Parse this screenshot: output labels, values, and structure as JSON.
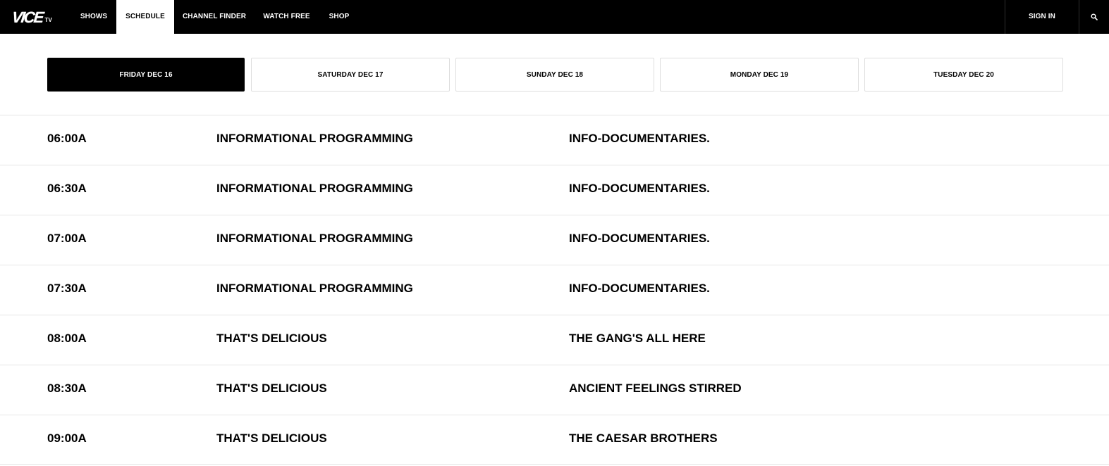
{
  "nav": {
    "logo_main": "VICE",
    "logo_suffix": "TV",
    "items": [
      {
        "label": "SHOWS"
      },
      {
        "label": "SCHEDULE"
      },
      {
        "label": "CHANNEL FINDER"
      },
      {
        "label": "WATCH FREE"
      },
      {
        "label": "SHOP"
      }
    ],
    "active_item": "SCHEDULE",
    "sign_in": "SIGN IN",
    "search_icon": "search-icon"
  },
  "date_tabs": [
    {
      "label": "FRIDAY DEC 16",
      "active": true
    },
    {
      "label": "SATURDAY DEC 17",
      "active": false
    },
    {
      "label": "SUNDAY DEC 18",
      "active": false
    },
    {
      "label": "MONDAY DEC 19",
      "active": false
    },
    {
      "label": "TUESDAY DEC 20",
      "active": false
    }
  ],
  "schedule": [
    {
      "time": "06:00A",
      "show": "INFORMATIONAL PROGRAMMING",
      "episode": "INFO-DOCUMENTARIES."
    },
    {
      "time": "06:30A",
      "show": "INFORMATIONAL PROGRAMMING",
      "episode": "INFO-DOCUMENTARIES."
    },
    {
      "time": "07:00A",
      "show": "INFORMATIONAL PROGRAMMING",
      "episode": "INFO-DOCUMENTARIES."
    },
    {
      "time": "07:30A",
      "show": "INFORMATIONAL PROGRAMMING",
      "episode": "INFO-DOCUMENTARIES."
    },
    {
      "time": "08:00A",
      "show": "THAT'S DELICIOUS",
      "episode": "THE GANG'S ALL HERE"
    },
    {
      "time": "08:30A",
      "show": "THAT'S DELICIOUS",
      "episode": "ANCIENT FEELINGS STIRRED"
    },
    {
      "time": "09:00A",
      "show": "THAT'S DELICIOUS",
      "episode": "THE CAESAR BROTHERS"
    }
  ],
  "colors": {
    "nav_background": "#000000",
    "active_tab_background": "#000000",
    "page_background": "#ffffff",
    "divider": "#e6e6e6"
  }
}
